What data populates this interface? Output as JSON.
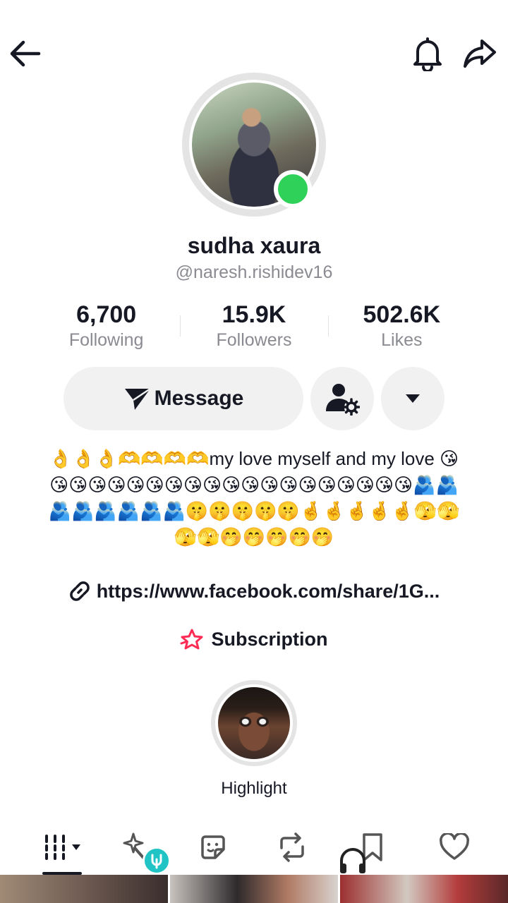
{
  "profile": {
    "display_name": "sudha xaura",
    "username": "@naresh.rishidev16",
    "online": true
  },
  "stats": [
    {
      "value": "6,700",
      "label": "Following"
    },
    {
      "value": "15.9K",
      "label": "Followers"
    },
    {
      "value": "502.6K",
      "label": "Likes"
    }
  ],
  "actions": {
    "message_label": "Message"
  },
  "bio": {
    "text": "👌👌👌🫶🫶🫶🫶my love myself and my love 😘😘😘😘😘😘😘😘😘😘😘😘😘😘😘😘😘😘😘😘🫂🫂🫂🫂🫂🫂🫂🫂🤫🤫🤫🤫🤫🤞🤞🤞🤞🤞🫣🫣🫣🫣🤭🤭🤭🤭🤭"
  },
  "link": {
    "text": "https://www.facebook.com/share/1G..."
  },
  "subscription": {
    "label": "Subscription"
  },
  "highlight": {
    "label": "Highlight"
  },
  "tabs": [
    {
      "icon": "grid-icon",
      "active": true
    },
    {
      "icon": "sparkle-icon",
      "active": false
    },
    {
      "icon": "sticker-icon",
      "active": false
    },
    {
      "icon": "repost-icon",
      "active": false
    },
    {
      "icon": "bookmark-icon",
      "active": false
    },
    {
      "icon": "heart-icon",
      "active": false
    }
  ],
  "colors": {
    "primary_text": "#161823",
    "secondary_text": "#8a8b91",
    "button_bg": "#f1f1f2",
    "online": "#30d158",
    "subscription_accent": "#fe2c55"
  }
}
